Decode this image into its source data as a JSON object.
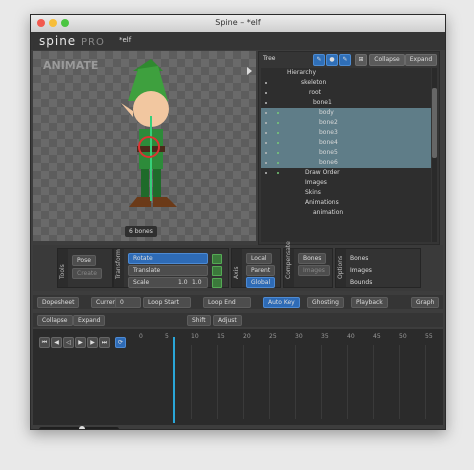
{
  "window": {
    "title": "Spine – *elf"
  },
  "menu": {
    "logo": "spine",
    "logo_pro": "PRO",
    "file": "*elf"
  },
  "viewport": {
    "mode_label": "ANIMATE",
    "bones_count": "6 bones"
  },
  "tree": {
    "header": "Tree",
    "collapse": "Collapse",
    "expand": "Expand",
    "hierarchy": "Hierarchy",
    "rows": [
      "skeleton",
      "root",
      "bone1",
      "body",
      "bone2",
      "bone3",
      "bone4",
      "bone5",
      "bone6",
      "Draw Order",
      "Images",
      "Skins",
      "Animations",
      "animation"
    ]
  },
  "tools": {
    "tools_label": "Tools",
    "pose": "Pose",
    "create": "Create",
    "transform_label": "Transform",
    "rotate": "Rotate",
    "translate": "Translate",
    "scale": "Scale",
    "scale_x": "1.0",
    "scale_y": "1.0",
    "axis_label": "Axis",
    "local": "Local",
    "parent": "Parent",
    "global": "Global",
    "compensate_label": "Compensate",
    "bones": "Bones",
    "images": "Images",
    "options_label": "Options",
    "opt_bones": "Bones",
    "opt_images": "Images",
    "opt_bounds": "Bounds"
  },
  "dopesheet": {
    "title": "Dopesheet",
    "current": "Current",
    "current_value": "0",
    "loop_start": "Loop Start",
    "loop_end": "Loop End",
    "auto_key": "Auto Key",
    "ghosting": "Ghosting",
    "playback": "Playback",
    "graph": "Graph",
    "collapse": "Collapse",
    "expand": "Expand",
    "shift": "Shift",
    "adjust": "Adjust",
    "ticks": [
      "0",
      "5",
      "10",
      "15",
      "20",
      "25",
      "30",
      "35",
      "40",
      "45",
      "50",
      "55"
    ]
  }
}
